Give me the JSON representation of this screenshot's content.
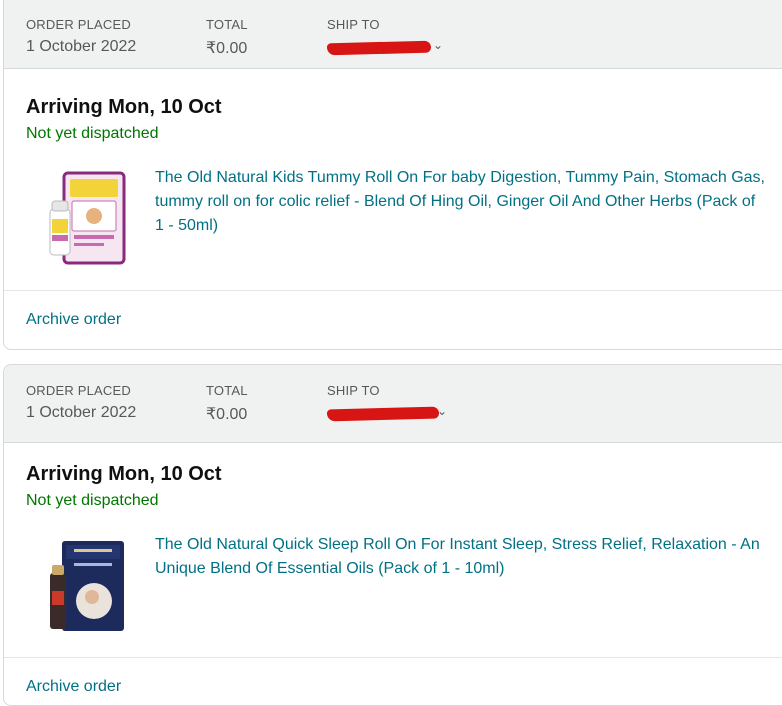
{
  "orders": [
    {
      "order_placed_label": "ORDER PLACED",
      "order_placed_date": "1 October 2022",
      "total_label": "TOTAL",
      "total_value": "₹0.00",
      "ship_to_label": "SHIP TO",
      "arriving": "Arriving Mon, 10 Oct",
      "status": "Not yet dispatched",
      "product_title": "The Old Natural Kids Tummy Roll On For baby Digestion, Tummy Pain, Stomach Gas, tummy roll on for colic relief - Blend Of Hing Oil, Ginger Oil And Other Herbs (Pack of 1 - 50ml)",
      "archive_label": "Archive order"
    },
    {
      "order_placed_label": "ORDER PLACED",
      "order_placed_date": "1 October 2022",
      "total_label": "TOTAL",
      "total_value": "₹0.00",
      "ship_to_label": "SHIP TO",
      "arriving": "Arriving Mon, 10 Oct",
      "status": "Not yet dispatched",
      "product_title": "The Old Natural Quick Sleep Roll On For Instant Sleep, Stress Relief, Relaxation - An Unique Blend Of Essential Oils (Pack of 1 - 10ml)",
      "archive_label": "Archive order"
    }
  ],
  "colors": {
    "header_bg": "#f0f2f2",
    "link": "#007185",
    "status_green": "#007600",
    "redaction": "#d81515"
  },
  "icons": [
    "chevron-down-icon"
  ]
}
